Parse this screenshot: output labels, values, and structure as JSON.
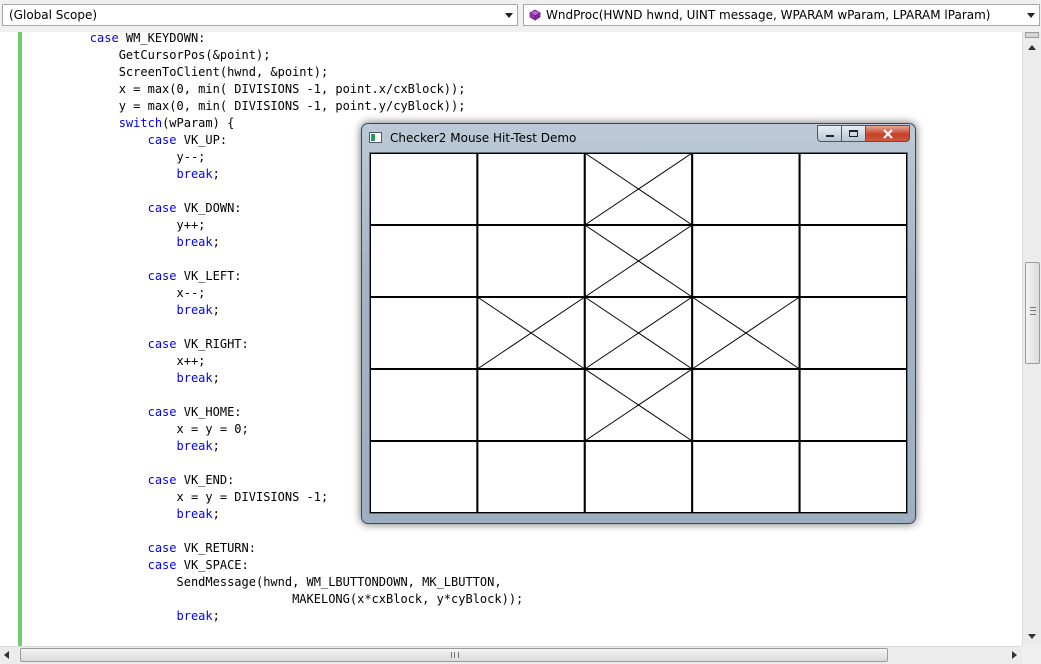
{
  "scope_combo": {
    "value": "(Global Scope)"
  },
  "function_combo": {
    "value": "WndProc(HWND hwnd, UINT message, WPARAM wParam, LPARAM lParam)"
  },
  "code_lines": [
    [
      {
        "t": "        "
      },
      {
        "t": "case",
        "k": 1
      },
      {
        "t": " WM_KEYDOWN:"
      }
    ],
    [
      {
        "t": "            GetCursorPos(&point);"
      }
    ],
    [
      {
        "t": "            ScreenToClient(hwnd, &point);"
      }
    ],
    [
      {
        "t": "            x = max(0, min( DIVISIONS -1, point.x/cxBlock));"
      }
    ],
    [
      {
        "t": "            y = max(0, min( DIVISIONS -1, point.y/cyBlock));"
      }
    ],
    [
      {
        "t": "            "
      },
      {
        "t": "switch",
        "k": 1
      },
      {
        "t": "(wParam) {"
      }
    ],
    [
      {
        "t": "                "
      },
      {
        "t": "case",
        "k": 1
      },
      {
        "t": " VK_UP:"
      }
    ],
    [
      {
        "t": "                    y--;"
      }
    ],
    [
      {
        "t": "                    "
      },
      {
        "t": "break",
        "k": 1
      },
      {
        "t": ";"
      }
    ],
    [
      {
        "t": ""
      }
    ],
    [
      {
        "t": "                "
      },
      {
        "t": "case",
        "k": 1
      },
      {
        "t": " VK_DOWN:"
      }
    ],
    [
      {
        "t": "                    y++;"
      }
    ],
    [
      {
        "t": "                    "
      },
      {
        "t": "break",
        "k": 1
      },
      {
        "t": ";"
      }
    ],
    [
      {
        "t": ""
      }
    ],
    [
      {
        "t": "                "
      },
      {
        "t": "case",
        "k": 1
      },
      {
        "t": " VK_LEFT:"
      }
    ],
    [
      {
        "t": "                    x--;"
      }
    ],
    [
      {
        "t": "                    "
      },
      {
        "t": "break",
        "k": 1
      },
      {
        "t": ";"
      }
    ],
    [
      {
        "t": ""
      }
    ],
    [
      {
        "t": "                "
      },
      {
        "t": "case",
        "k": 1
      },
      {
        "t": " VK_RIGHT:"
      }
    ],
    [
      {
        "t": "                    x++;"
      }
    ],
    [
      {
        "t": "                    "
      },
      {
        "t": "break",
        "k": 1
      },
      {
        "t": ";"
      }
    ],
    [
      {
        "t": ""
      }
    ],
    [
      {
        "t": "                "
      },
      {
        "t": "case",
        "k": 1
      },
      {
        "t": " VK_HOME:"
      }
    ],
    [
      {
        "t": "                    x = y = 0;"
      }
    ],
    [
      {
        "t": "                    "
      },
      {
        "t": "break",
        "k": 1
      },
      {
        "t": ";"
      }
    ],
    [
      {
        "t": ""
      }
    ],
    [
      {
        "t": "                "
      },
      {
        "t": "case",
        "k": 1
      },
      {
        "t": " VK_END:"
      }
    ],
    [
      {
        "t": "                    x = y = DIVISIONS -1;"
      }
    ],
    [
      {
        "t": "                    "
      },
      {
        "t": "break",
        "k": 1
      },
      {
        "t": ";"
      }
    ],
    [
      {
        "t": ""
      }
    ],
    [
      {
        "t": "                "
      },
      {
        "t": "case",
        "k": 1
      },
      {
        "t": " VK_RETURN:"
      }
    ],
    [
      {
        "t": "                "
      },
      {
        "t": "case",
        "k": 1
      },
      {
        "t": " VK_SPACE:"
      }
    ],
    [
      {
        "t": "                    SendMessage(hwnd, WM_LBUTTONDOWN, MK_LBUTTON,"
      }
    ],
    [
      {
        "t": "                                    MAKELONG(x*cxBlock, y*cyBlock));"
      }
    ],
    [
      {
        "t": "                    "
      },
      {
        "t": "break",
        "k": 1
      },
      {
        "t": ";"
      }
    ]
  ],
  "colors": {
    "keyword": "#0000ff",
    "change_bar": "#6ece6e",
    "grid_line": "#000000"
  },
  "demo_window": {
    "title": "Checker2 Mouse Hit-Test Demo",
    "icon": "app-window-icon",
    "buttons": [
      "minimize-icon",
      "maximize-icon",
      "close-icon"
    ],
    "grid": {
      "columns": 5,
      "rows": 5,
      "checked": [
        [
          0,
          2
        ],
        [
          1,
          2
        ],
        [
          2,
          1
        ],
        [
          2,
          2
        ],
        [
          2,
          3
        ],
        [
          3,
          2
        ]
      ]
    }
  }
}
